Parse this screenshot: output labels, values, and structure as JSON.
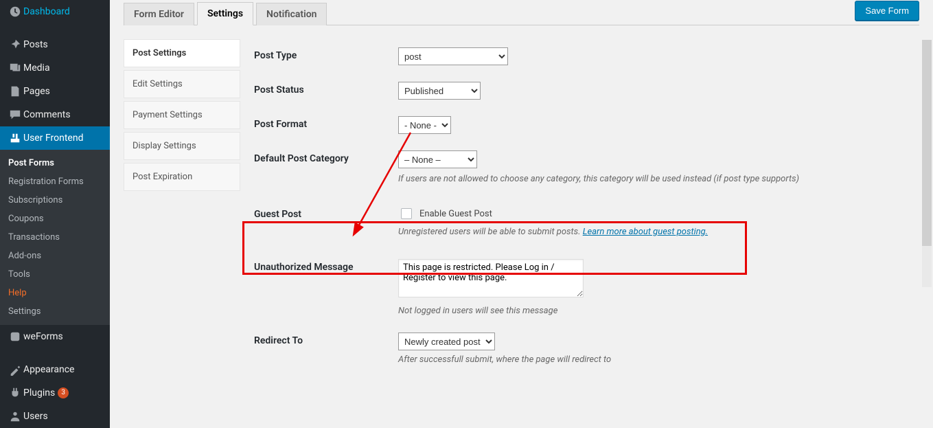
{
  "sidebar": {
    "items": [
      {
        "label": "Dashboard"
      },
      {
        "label": "Posts"
      },
      {
        "label": "Media"
      },
      {
        "label": "Pages"
      },
      {
        "label": "Comments"
      },
      {
        "label": "User Frontend"
      },
      {
        "label": "weForms"
      },
      {
        "label": "Appearance"
      },
      {
        "label": "Plugins"
      },
      {
        "label": "Users"
      }
    ],
    "plugin_update_count": "3",
    "submenu": [
      {
        "label": "Post Forms"
      },
      {
        "label": "Registration Forms"
      },
      {
        "label": "Subscriptions"
      },
      {
        "label": "Coupons"
      },
      {
        "label": "Transactions"
      },
      {
        "label": "Add-ons"
      },
      {
        "label": "Tools"
      },
      {
        "label": "Help"
      },
      {
        "label": "Settings"
      }
    ]
  },
  "tabs": {
    "form_editor": "Form Editor",
    "settings": "Settings",
    "notification": "Notification",
    "save": "Save Form"
  },
  "settings_nav": [
    "Post Settings",
    "Edit Settings",
    "Payment Settings",
    "Display Settings",
    "Post Expiration"
  ],
  "form": {
    "post_type": {
      "label": "Post Type",
      "value": "post"
    },
    "post_status": {
      "label": "Post Status",
      "value": "Published"
    },
    "post_format": {
      "label": "Post Format",
      "value": "- None -"
    },
    "default_category": {
      "label": "Default Post Category",
      "value": "– None –",
      "help": "If users are not allowed to choose any category, this category will be used instead (if post type supports)"
    },
    "guest_post": {
      "label": "Guest Post",
      "checkbox_label": "Enable Guest Post",
      "help_prefix": "Unregistered users will be able to submit posts. ",
      "help_link": "Learn more about guest posting."
    },
    "unauth": {
      "label": "Unauthorized Message",
      "value": "This page is restricted. Please Log in / Register to view this page.",
      "help": "Not logged in users will see this message"
    },
    "redirect": {
      "label": "Redirect To",
      "value": "Newly created post",
      "help": "After successfull submit, where the page will redirect to"
    }
  }
}
